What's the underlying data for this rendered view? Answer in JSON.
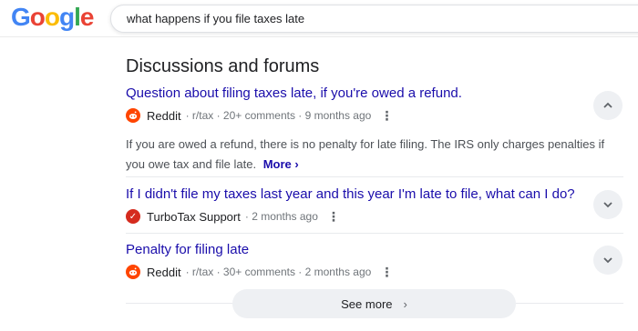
{
  "header": {
    "logo": {
      "letters": [
        "G",
        "o",
        "o",
        "g",
        "l",
        "e"
      ],
      "colors": [
        "#4285F4",
        "#EA4335",
        "#FBBC05",
        "#4285F4",
        "#34A853",
        "#EA4335"
      ]
    },
    "search": {
      "query": "what happens if you file taxes late"
    }
  },
  "section": {
    "title": "Discussions and forums"
  },
  "items": [
    {
      "title": "Question about filing taxes late, if you're owed a refund.",
      "source": "Reddit",
      "meta": "· r/tax · 20+ comments · 9 months ago",
      "icon": "reddit-icon",
      "snippet": "If you are owed a refund, there is no penalty for late filing. The IRS only charges penalties if you owe tax and file late.",
      "more_label": "More",
      "expanded": true
    },
    {
      "title": "If I didn't file my taxes last year and this year I'm late to file, what can I do?",
      "source": "TurboTax Support",
      "meta": "· 2 months ago",
      "icon": "turbotax-icon",
      "expanded": false
    },
    {
      "title": "Penalty for filing late",
      "source": "Reddit",
      "meta": "· r/tax · 30+ comments · 2 months ago",
      "icon": "reddit-icon",
      "expanded": false
    }
  ],
  "see_more": {
    "label": "See more"
  },
  "colors": {
    "link": "#1a0dab",
    "reddit": "#ff4500",
    "turbotax": "#d52b1e"
  }
}
